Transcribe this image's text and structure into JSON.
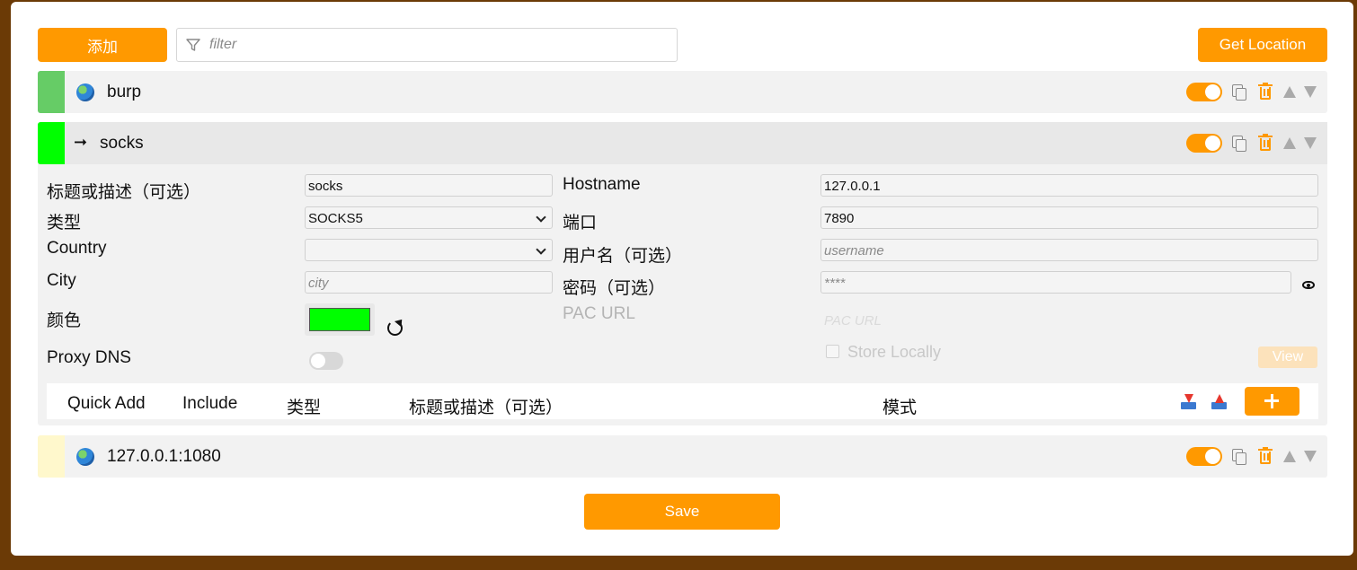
{
  "toolbar": {
    "add_label": "添加",
    "filter_placeholder": "filter",
    "get_location_label": "Get Location"
  },
  "proxies": [
    {
      "title": "burp",
      "icon": "globe-icon",
      "color": "#66cc66",
      "enabled": true
    },
    {
      "title": "socks",
      "icon": "arrow-right-icon",
      "color": "#00ff00",
      "enabled": true,
      "expanded": true
    },
    {
      "title": "127.0.0.1:1080",
      "icon": "globe-icon",
      "color": "#fff8cc",
      "enabled": true
    }
  ],
  "editor": {
    "title_label": "标题或描述（可选）",
    "title_value": "socks",
    "type_label": "类型",
    "type_value": "SOCKS5",
    "country_label": "Country",
    "country_value": "",
    "city_label": "City",
    "city_placeholder": "city",
    "color_label": "颜色",
    "color_value": "#00ff00",
    "proxy_dns_label": "Proxy DNS",
    "proxy_dns_on": false,
    "hostname_label": "Hostname",
    "hostname_value": "127.0.0.1",
    "port_label": "端口",
    "port_value": "7890",
    "username_label": "用户名（可选）",
    "username_placeholder": "username",
    "password_label": "密码（可选）",
    "password_placeholder": "****",
    "pac_url_label": "PAC URL",
    "pac_url_placeholder": "PAC URL",
    "store_locally_label": "Store Locally",
    "view_label": "View"
  },
  "patterns": {
    "headers": [
      "Quick Add",
      "Include",
      "类型",
      "标题或描述（可选）",
      "模式"
    ]
  },
  "footer": {
    "save_label": "Save"
  },
  "colors": {
    "accent": "#ff9900",
    "frame": "#6b3a06"
  }
}
